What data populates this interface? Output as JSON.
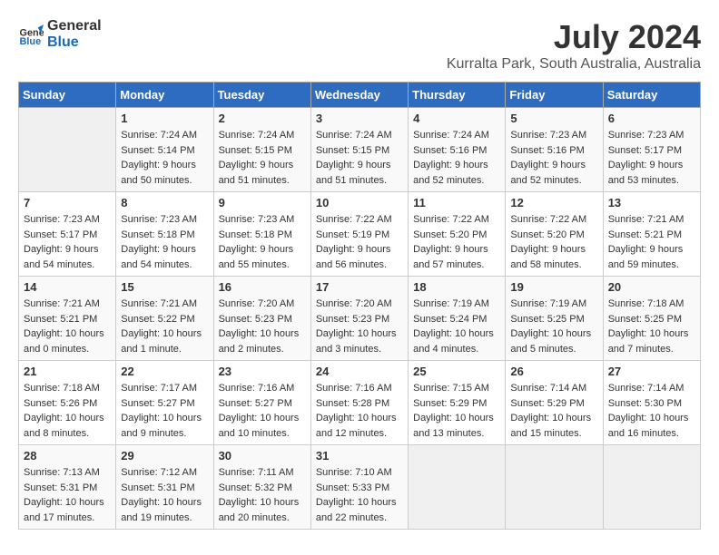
{
  "header": {
    "logo_line1": "General",
    "logo_line2": "Blue",
    "title": "July 2024",
    "subtitle": "Kurralta Park, South Australia, Australia"
  },
  "weekdays": [
    "Sunday",
    "Monday",
    "Tuesday",
    "Wednesday",
    "Thursday",
    "Friday",
    "Saturday"
  ],
  "weeks": [
    [
      {
        "day": "",
        "empty": true
      },
      {
        "day": "1",
        "sunrise": "7:24 AM",
        "sunset": "5:14 PM",
        "daylight": "9 hours and 50 minutes."
      },
      {
        "day": "2",
        "sunrise": "7:24 AM",
        "sunset": "5:15 PM",
        "daylight": "9 hours and 51 minutes."
      },
      {
        "day": "3",
        "sunrise": "7:24 AM",
        "sunset": "5:15 PM",
        "daylight": "9 hours and 51 minutes."
      },
      {
        "day": "4",
        "sunrise": "7:24 AM",
        "sunset": "5:16 PM",
        "daylight": "9 hours and 52 minutes."
      },
      {
        "day": "5",
        "sunrise": "7:23 AM",
        "sunset": "5:16 PM",
        "daylight": "9 hours and 52 minutes."
      },
      {
        "day": "6",
        "sunrise": "7:23 AM",
        "sunset": "5:17 PM",
        "daylight": "9 hours and 53 minutes."
      }
    ],
    [
      {
        "day": "7",
        "sunrise": "7:23 AM",
        "sunset": "5:17 PM",
        "daylight": "9 hours and 54 minutes."
      },
      {
        "day": "8",
        "sunrise": "7:23 AM",
        "sunset": "5:18 PM",
        "daylight": "9 hours and 54 minutes."
      },
      {
        "day": "9",
        "sunrise": "7:23 AM",
        "sunset": "5:18 PM",
        "daylight": "9 hours and 55 minutes."
      },
      {
        "day": "10",
        "sunrise": "7:22 AM",
        "sunset": "5:19 PM",
        "daylight": "9 hours and 56 minutes."
      },
      {
        "day": "11",
        "sunrise": "7:22 AM",
        "sunset": "5:20 PM",
        "daylight": "9 hours and 57 minutes."
      },
      {
        "day": "12",
        "sunrise": "7:22 AM",
        "sunset": "5:20 PM",
        "daylight": "9 hours and 58 minutes."
      },
      {
        "day": "13",
        "sunrise": "7:21 AM",
        "sunset": "5:21 PM",
        "daylight": "9 hours and 59 minutes."
      }
    ],
    [
      {
        "day": "14",
        "sunrise": "7:21 AM",
        "sunset": "5:21 PM",
        "daylight": "10 hours and 0 minutes."
      },
      {
        "day": "15",
        "sunrise": "7:21 AM",
        "sunset": "5:22 PM",
        "daylight": "10 hours and 1 minute."
      },
      {
        "day": "16",
        "sunrise": "7:20 AM",
        "sunset": "5:23 PM",
        "daylight": "10 hours and 2 minutes."
      },
      {
        "day": "17",
        "sunrise": "7:20 AM",
        "sunset": "5:23 PM",
        "daylight": "10 hours and 3 minutes."
      },
      {
        "day": "18",
        "sunrise": "7:19 AM",
        "sunset": "5:24 PM",
        "daylight": "10 hours and 4 minutes."
      },
      {
        "day": "19",
        "sunrise": "7:19 AM",
        "sunset": "5:25 PM",
        "daylight": "10 hours and 5 minutes."
      },
      {
        "day": "20",
        "sunrise": "7:18 AM",
        "sunset": "5:25 PM",
        "daylight": "10 hours and 7 minutes."
      }
    ],
    [
      {
        "day": "21",
        "sunrise": "7:18 AM",
        "sunset": "5:26 PM",
        "daylight": "10 hours and 8 minutes."
      },
      {
        "day": "22",
        "sunrise": "7:17 AM",
        "sunset": "5:27 PM",
        "daylight": "10 hours and 9 minutes."
      },
      {
        "day": "23",
        "sunrise": "7:16 AM",
        "sunset": "5:27 PM",
        "daylight": "10 hours and 10 minutes."
      },
      {
        "day": "24",
        "sunrise": "7:16 AM",
        "sunset": "5:28 PM",
        "daylight": "10 hours and 12 minutes."
      },
      {
        "day": "25",
        "sunrise": "7:15 AM",
        "sunset": "5:29 PM",
        "daylight": "10 hours and 13 minutes."
      },
      {
        "day": "26",
        "sunrise": "7:14 AM",
        "sunset": "5:29 PM",
        "daylight": "10 hours and 15 minutes."
      },
      {
        "day": "27",
        "sunrise": "7:14 AM",
        "sunset": "5:30 PM",
        "daylight": "10 hours and 16 minutes."
      }
    ],
    [
      {
        "day": "28",
        "sunrise": "7:13 AM",
        "sunset": "5:31 PM",
        "daylight": "10 hours and 17 minutes."
      },
      {
        "day": "29",
        "sunrise": "7:12 AM",
        "sunset": "5:31 PM",
        "daylight": "10 hours and 19 minutes."
      },
      {
        "day": "30",
        "sunrise": "7:11 AM",
        "sunset": "5:32 PM",
        "daylight": "10 hours and 20 minutes."
      },
      {
        "day": "31",
        "sunrise": "7:10 AM",
        "sunset": "5:33 PM",
        "daylight": "10 hours and 22 minutes."
      },
      {
        "day": "",
        "empty": true
      },
      {
        "day": "",
        "empty": true
      },
      {
        "day": "",
        "empty": true
      }
    ]
  ],
  "labels": {
    "sunrise": "Sunrise:",
    "sunset": "Sunset:",
    "daylight": "Daylight:"
  },
  "colors": {
    "header_bg": "#2d6cc0",
    "header_text": "#ffffff"
  }
}
